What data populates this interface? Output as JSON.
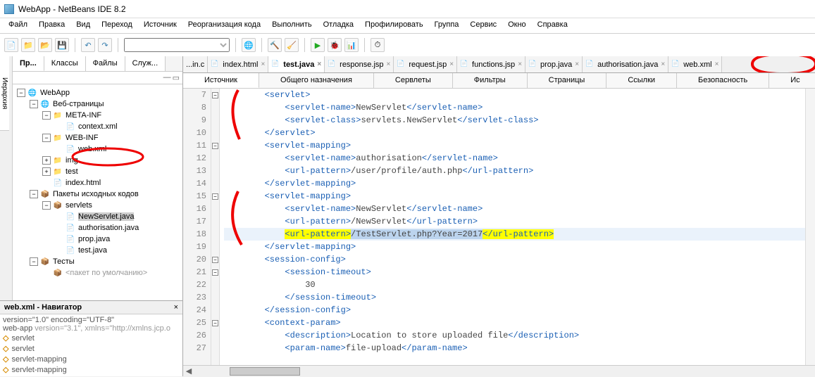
{
  "title": "WebApp - NetBeans IDE 8.2",
  "menu": [
    "Файл",
    "Правка",
    "Вид",
    "Переход",
    "Источник",
    "Реорганизация кода",
    "Выполнить",
    "Отладка",
    "Профилировать",
    "Группа",
    "Сервис",
    "Окно",
    "Справка"
  ],
  "vtab": "Иерархия",
  "proj_tabs": [
    "Пр...",
    "Классы",
    "Файлы",
    "Служ..."
  ],
  "tree": {
    "root": "WebApp",
    "web": "Веб-страницы",
    "meta": "META-INF",
    "ctx": "context.xml",
    "webinf": "WEB-INF",
    "webxml": "web.xml",
    "img": "img",
    "test": "test",
    "idx": "index.html",
    "pkgs": "Пакеты исходных кодов",
    "servlets": "servlets",
    "ns": "NewServlet.java",
    "auth": "authorisation.java",
    "prop": "prop.java",
    "tj": "test.java",
    "tests": "Тесты",
    "defpkg": "<пакет по умолчанию>"
  },
  "nav": {
    "title": "web.xml - Навигатор",
    "l1pre": "version=\"1.0\" encoding=\"UTF-8\"",
    "l2pre": "web-app ",
    "l2gray": "version=\"3.1\", xmlns=\"http://xmlns.jcp.o",
    "items": [
      "servlet",
      "servlet",
      "servlet-mapping",
      "servlet-mapping"
    ]
  },
  "ed_tabs": [
    {
      "lbl": "...in.c",
      "active": false,
      "icon": ""
    },
    {
      "lbl": "index.html",
      "active": false,
      "icon": "📄"
    },
    {
      "lbl": "test.java",
      "active": true,
      "icon": "📄"
    },
    {
      "lbl": "response.jsp",
      "active": false,
      "icon": "📄"
    },
    {
      "lbl": "request.jsp",
      "active": false,
      "icon": "📄"
    },
    {
      "lbl": "functions.jsp",
      "active": false,
      "icon": "📄"
    },
    {
      "lbl": "prop.java",
      "active": false,
      "icon": "📄"
    },
    {
      "lbl": "authorisation.java",
      "active": false,
      "icon": "📄"
    },
    {
      "lbl": "web.xml",
      "active": false,
      "icon": "📄"
    }
  ],
  "subtabs": [
    "Источник",
    "Общего назначения",
    "Сервлеты",
    "Фильтры",
    "Страницы",
    "Ссылки",
    "Безопасность",
    "Ис"
  ],
  "lines": {
    "n": [
      "7",
      "8",
      "9",
      "10",
      "11",
      "12",
      "13",
      "14",
      "15",
      "16",
      "17",
      "18",
      "19",
      "20",
      "21",
      "22",
      "23",
      "24",
      "25",
      "26",
      "27"
    ]
  },
  "code": {
    "l7": "        <servlet>",
    "l8a": "            <servlet-name>",
    "l8b": "NewServlet",
    "l8c": "</servlet-name>",
    "l9a": "            <servlet-class>",
    "l9b": "servlets.NewServlet",
    "l9c": "</servlet-class>",
    "l10": "        </servlet>",
    "l11": "        <servlet-mapping>",
    "l12a": "            <servlet-name>",
    "l12b": "authorisation",
    "l12c": "</servlet-name>",
    "l13a": "            <url-pattern>",
    "l13b": "/user/profile/auth.php",
    "l13c": "</url-pattern>",
    "l14": "        </servlet-mapping>",
    "l15": "        <servlet-mapping>",
    "l16a": "            <servlet-name>",
    "l16b": "NewServlet",
    "l16c": "</servlet-name>",
    "l17a": "            <url-pattern>",
    "l17b": "/NewServlet",
    "l17c": "</url-pattern>",
    "l18pad": "            ",
    "l18a": "<url-pattern>",
    "l18b": "/TestServlet.php?Year=2017",
    "l18c": "</url-pattern>",
    "l19": "        </servlet-mapping>",
    "l20": "        <session-config>",
    "l21": "            <session-timeout>",
    "l22": "                30",
    "l23": "            </session-timeout>",
    "l24": "        </session-config>",
    "l25": "        <context-param>",
    "l26a": "            <description>",
    "l26b": "Location to store uploaded file",
    "l26c": "</description>",
    "l27a": "            <param-name>",
    "l27b": "file-upload",
    "l27c": "</param-name>"
  }
}
